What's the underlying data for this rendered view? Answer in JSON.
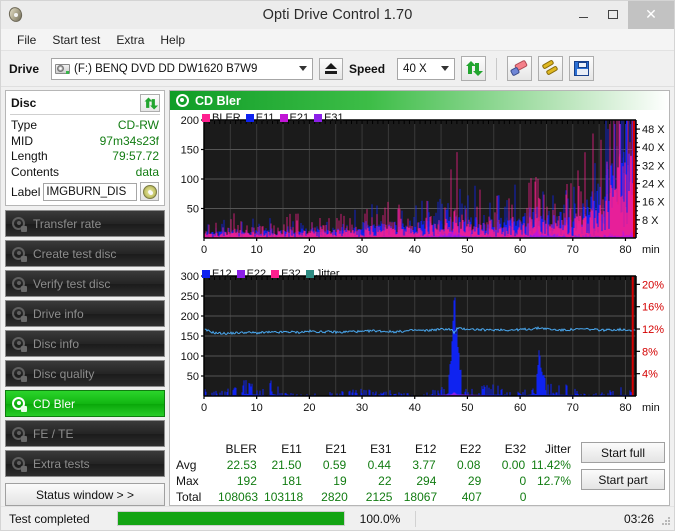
{
  "window": {
    "title": "Opti Drive Control 1.70",
    "app_icon": "disc-icon",
    "minimize": "–",
    "maximize": "□",
    "close": "✕"
  },
  "menu": {
    "items": [
      "File",
      "Start test",
      "Extra",
      "Help"
    ]
  },
  "toolbar": {
    "drive_label": "Drive",
    "drive_value": "(F:)   BENQ DVD DD DW1620 B7W9",
    "eject_icon": "eject-icon",
    "speed_label": "Speed",
    "speed_value": "40 X",
    "refresh_icon": "refresh-icon",
    "erase_icon": "erase-icon",
    "tools_icon": "tools-icon",
    "save_icon": "save-icon"
  },
  "disc": {
    "header": "Disc",
    "refresh_icon": "refresh-icon",
    "rows": [
      {
        "key": "Type",
        "value": "CD-RW"
      },
      {
        "key": "MID",
        "value": "97m34s23f"
      },
      {
        "key": "Length",
        "value": "79:57.72"
      },
      {
        "key": "Contents",
        "value": "data"
      }
    ],
    "label_key": "Label",
    "label_value": "IMGBURN_DIS",
    "disc_icon": "cd-icon"
  },
  "nav": {
    "items": [
      {
        "label": "Transfer rate",
        "active": false
      },
      {
        "label": "Create test disc",
        "active": false
      },
      {
        "label": "Verify test disc",
        "active": false
      },
      {
        "label": "Drive info",
        "active": false
      },
      {
        "label": "Disc info",
        "active": false
      },
      {
        "label": "Disc quality",
        "active": false
      },
      {
        "label": "CD Bler",
        "active": true
      },
      {
        "label": "FE / TE",
        "active": false
      },
      {
        "label": "Extra tests",
        "active": false
      }
    ],
    "status_window": "Status window > >"
  },
  "pane": {
    "title": "CD Bler",
    "icon": "disc-icon"
  },
  "stats": {
    "columns": [
      "BLER",
      "E11",
      "E21",
      "E31",
      "E12",
      "E22",
      "E32",
      "Jitter"
    ],
    "rows": [
      {
        "label": "Avg",
        "values": [
          "22.53",
          "21.50",
          "0.59",
          "0.44",
          "3.77",
          "0.08",
          "0.00",
          "11.42%"
        ]
      },
      {
        "label": "Max",
        "values": [
          "192",
          "181",
          "19",
          "22",
          "294",
          "29",
          "0",
          "12.7%"
        ]
      },
      {
        "label": "Total",
        "values": [
          "108063",
          "103118",
          "2820",
          "2125",
          "18067",
          "407",
          "0",
          ""
        ]
      }
    ],
    "start_full": "Start full",
    "start_part": "Start part"
  },
  "statusbar": {
    "message": "Test completed",
    "progress_pct": "100.0%",
    "progress_value": 100,
    "elapsed": "03:26"
  },
  "colors": {
    "bler": "#ff1f8f",
    "e11": "#0f23f0",
    "e21": "#c215d6",
    "e31": "#8b1fe8",
    "e12": "#0f23f0",
    "e22": "#8b1fe8",
    "e32": "#ff1f8f",
    "jitter": "#2e8b82",
    "jitter_line": "#4aa8ef",
    "accent_green": "#13a413",
    "value_green": "#127c12",
    "speed_axis": "#111111",
    "jitter_axis": "#d40000"
  },
  "chart_data": [
    {
      "type": "area",
      "id": "cd-bler-top",
      "title": "CD Bler",
      "xlabel": "min",
      "ylabel": "",
      "xlim": [
        0,
        82
      ],
      "ylim": [
        0,
        200
      ],
      "xticks": [
        0,
        10,
        20,
        30,
        40,
        50,
        60,
        70,
        80
      ],
      "yticks": [
        50,
        100,
        150,
        200
      ],
      "right_axis": {
        "label": "X",
        "ticks": [
          "8 X",
          "16 X",
          "24 X",
          "32 X",
          "40 X",
          "48 X"
        ],
        "lim": [
          0,
          52
        ]
      },
      "grid": true,
      "legend": [
        "BLER",
        "E11",
        "E21",
        "E31"
      ],
      "legend_position": "top-left",
      "background": "#1b1b1b",
      "series": [
        {
          "name": "BLER",
          "color": "#ff1f8f",
          "description": "Pink block error rate, baseline ~8-20 across 0-45 min, spike cluster ~48 min to 55, broad bump at 63 min to 45, rising strongly after 72 min reaching ~190 at 81 min",
          "x": [
            0,
            3,
            6,
            9,
            12,
            15,
            18,
            21,
            24,
            27,
            30,
            33,
            36,
            39,
            42,
            45,
            47,
            48,
            50,
            53,
            56,
            59,
            62,
            63,
            64,
            66,
            68,
            70,
            72,
            74,
            76,
            78,
            79,
            80,
            81
          ],
          "values": [
            9,
            10,
            11,
            10,
            12,
            11,
            13,
            12,
            14,
            13,
            16,
            18,
            20,
            22,
            24,
            26,
            40,
            55,
            28,
            24,
            26,
            25,
            27,
            45,
            30,
            28,
            32,
            35,
            40,
            55,
            70,
            110,
            150,
            180,
            192
          ]
        },
        {
          "name": "E11",
          "color": "#0f23f0",
          "description": "Blue filled area, baseline ~7-16, gradually rising after 55 min, steep ramp after 75 min peaking ~181",
          "x": [
            0,
            3,
            6,
            9,
            12,
            15,
            18,
            21,
            24,
            27,
            30,
            33,
            36,
            39,
            42,
            45,
            47,
            48,
            50,
            53,
            56,
            59,
            62,
            63,
            64,
            66,
            68,
            70,
            72,
            74,
            76,
            78,
            79,
            80,
            81
          ],
          "values": [
            7,
            8,
            9,
            8,
            10,
            9,
            11,
            10,
            12,
            11,
            14,
            16,
            18,
            19,
            21,
            22,
            24,
            26,
            24,
            22,
            24,
            23,
            25,
            26,
            27,
            26,
            30,
            33,
            38,
            50,
            66,
            100,
            140,
            168,
            181
          ]
        },
        {
          "name": "E21",
          "color": "#c215d6",
          "description": "Purple, very low baseline 0-2 with small humps at 47 and 63 min",
          "x": [
            0,
            10,
            20,
            30,
            40,
            46,
            47,
            48,
            50,
            60,
            62,
            63,
            64,
            70,
            75,
            80,
            81
          ],
          "values": [
            0,
            0,
            0,
            1,
            1,
            5,
            9,
            6,
            1,
            1,
            4,
            8,
            5,
            1,
            2,
            4,
            6
          ]
        },
        {
          "name": "E31",
          "color": "#8b1fe8",
          "description": "Violet, near zero throughout",
          "x": [
            0,
            20,
            40,
            47,
            60,
            63,
            80,
            81
          ],
          "values": [
            0,
            0,
            0,
            3,
            0,
            3,
            1,
            2
          ]
        }
      ]
    },
    {
      "type": "line",
      "id": "cd-bler-bottom",
      "title": "",
      "xlabel": "min",
      "ylabel": "",
      "xlim": [
        0,
        82
      ],
      "ylim": [
        0,
        300
      ],
      "xticks": [
        0,
        10,
        20,
        30,
        40,
        50,
        60,
        70,
        80
      ],
      "yticks": [
        50,
        100,
        150,
        200,
        250,
        300
      ],
      "right_axis": {
        "label": "%",
        "ticks": [
          "4%",
          "8%",
          "12%",
          "16%",
          "20%"
        ],
        "lim": [
          0,
          21.5
        ],
        "color": "#d40000"
      },
      "grid": true,
      "legend": [
        "E12",
        "E22",
        "E32",
        "Jitter"
      ],
      "legend_position": "top-left",
      "background": "#1b1b1b",
      "series": [
        {
          "name": "E12",
          "color": "#0f23f0",
          "description": "Blue spikes from baseline 0; scattered spikes 10-50 high in 0-15 min, huge spike ~294 at 47.5 min, secondary spike ~120 at 63.5 min, small cluster near 80 min",
          "x": [
            0,
            1,
            2,
            4,
            6,
            7,
            8,
            9,
            10,
            12,
            13,
            14,
            16,
            20,
            23,
            24,
            25,
            28,
            29,
            33,
            35,
            38,
            41,
            44,
            46,
            47,
            47.5,
            48,
            49,
            56,
            58,
            60,
            63,
            63.5,
            64,
            65,
            70,
            71,
            75,
            79,
            80,
            81
          ],
          "values": [
            18,
            4,
            10,
            12,
            22,
            8,
            50,
            30,
            32,
            8,
            40,
            20,
            6,
            4,
            10,
            12,
            8,
            14,
            20,
            8,
            12,
            6,
            4,
            14,
            30,
            120,
            294,
            160,
            20,
            30,
            10,
            8,
            40,
            120,
            90,
            30,
            22,
            8,
            6,
            18,
            24,
            10
          ]
        },
        {
          "name": "E22",
          "color": "#8b1fe8",
          "description": "Violet, almost flat at zero with a tiny bump near 47.5 min",
          "x": [
            0,
            20,
            40,
            47,
            47.5,
            48,
            60,
            80
          ],
          "values": [
            0,
            0,
            0,
            4,
            10,
            4,
            0,
            0
          ]
        },
        {
          "name": "E32",
          "color": "#ff1f8f",
          "description": "Pink, flat at zero (total 0)",
          "x": [
            0,
            40,
            80
          ],
          "values": [
            0,
            0,
            0
          ]
        },
        {
          "name": "Jitter",
          "color": "#4aa8ef",
          "axis": "right",
          "unit": "%",
          "description": "Light blue jitter trace, noisy band between 11.0% and 12.4%, average 11.42%, max 12.7%, brief dip near 47.5 min",
          "x": [
            0,
            2,
            4,
            6,
            8,
            10,
            12,
            14,
            16,
            18,
            20,
            22,
            24,
            26,
            28,
            30,
            32,
            34,
            36,
            38,
            40,
            42,
            44,
            46,
            47,
            47.5,
            48,
            50,
            52,
            54,
            56,
            58,
            60,
            62,
            64,
            66,
            68,
            70,
            72,
            74,
            76,
            78,
            80,
            81
          ],
          "values": [
            11.9,
            11.3,
            11.2,
            11.3,
            11.4,
            11.3,
            11.4,
            11.4,
            11.5,
            11.4,
            11.6,
            11.5,
            11.5,
            11.4,
            11.6,
            11.5,
            11.7,
            11.6,
            11.5,
            11.6,
            11.8,
            11.7,
            11.9,
            12.0,
            11.9,
            11.2,
            12.1,
            12.0,
            11.9,
            11.8,
            11.9,
            11.8,
            11.9,
            12.0,
            12.2,
            11.9,
            11.8,
            11.9,
            12.0,
            11.9,
            11.8,
            11.9,
            11.9,
            11.8
          ]
        }
      ],
      "annotations": [
        {
          "type": "vline",
          "x": 81,
          "color": "#d40000",
          "description": "Red end-of-test marker line"
        }
      ]
    }
  ]
}
